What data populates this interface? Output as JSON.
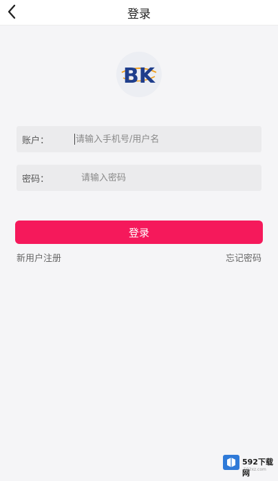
{
  "header": {
    "title": "登录",
    "back_icon": "chevron-left-icon"
  },
  "logo": {
    "text": "BK"
  },
  "account_field": {
    "label": "账户：",
    "placeholder": "请输入手机号/用户名",
    "value": ""
  },
  "password_field": {
    "label": "密码：",
    "placeholder": "请输入密码",
    "value": ""
  },
  "login_button": {
    "label": "登录"
  },
  "links": {
    "register": "新用户注册",
    "forgot_password": "忘记密码"
  },
  "watermark": {
    "text": "592下载网",
    "subtext": "592xz.com"
  },
  "colors": {
    "accent": "#f5195b",
    "background": "#f5f5f7",
    "field_bg": "#ebebed",
    "watermark_blue": "#2f7ad8"
  }
}
